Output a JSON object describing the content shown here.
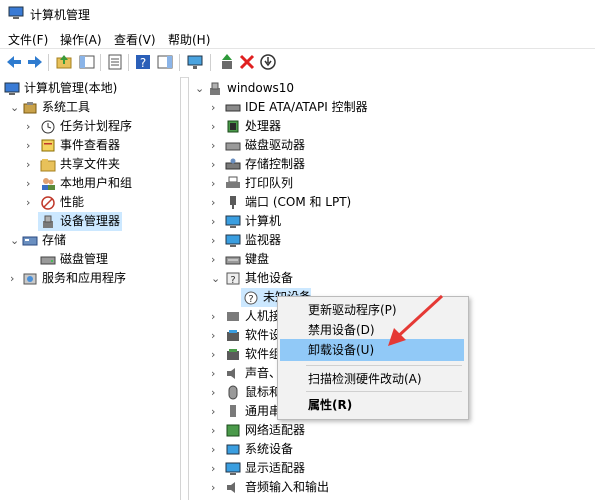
{
  "window": {
    "title": "计算机管理"
  },
  "menu": [
    "文件(F)",
    "操作(A)",
    "查看(V)",
    "帮助(H)"
  ],
  "toolbar": [
    "back-icon",
    "forward-icon",
    "up-folder-icon",
    "show-tree-icon",
    "properties-icon",
    "help-icon",
    "action-pane-icon",
    "monitor-icon",
    "update-driver-icon",
    "uninstall-icon",
    "disable-icon"
  ],
  "left_tree": {
    "root": "计算机管理(本地)",
    "system_tools": "系统工具",
    "task_scheduler": "任务计划程序",
    "event_viewer": "事件查看器",
    "shared_folders": "共享文件夹",
    "local_users": "本地用户和组",
    "performance": "性能",
    "device_manager": "设备管理器",
    "storage": "存储",
    "disk_mgmt": "磁盘管理",
    "services": "服务和应用程序"
  },
  "devices": {
    "root": "windows10",
    "items": [
      "IDE ATA/ATAPI 控制器",
      "处理器",
      "磁盘驱动器",
      "存储控制器",
      "打印队列",
      "端口 (COM 和 LPT)",
      "计算机",
      "监视器",
      "键盘",
      "其他设备",
      "未知设备",
      "人机接",
      "软件设",
      "软件组",
      "声音、",
      "鼠标和",
      "通用串",
      "网络适配器",
      "系统设备",
      "显示适配器",
      "音频输入和输出"
    ]
  },
  "context_menu": {
    "update": "更新驱动程序(P)",
    "disable": "禁用设备(D)",
    "uninstall": "卸载设备(U)",
    "scan": "扫描检测硬件改动(A)",
    "properties": "属性(R)"
  }
}
